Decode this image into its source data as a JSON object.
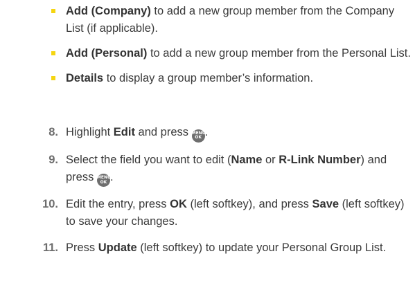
{
  "bullets": [
    {
      "bold": "Add (Company)",
      "text": " to add a new group member from the Company List (if applicable)."
    },
    {
      "bold": "Add (Personal)",
      "text": " to add a new group member from the Personal List."
    },
    {
      "bold": "Details",
      "text": " to display a group member’s information."
    }
  ],
  "steps": [
    {
      "num": "8.",
      "t1": "Highlight ",
      "b1": "Edit",
      "t2": " and press ",
      "key": [
        "MENU",
        "OK"
      ],
      "t3": "."
    },
    {
      "num": "9.",
      "t1": "Select the field you want to edit (",
      "b1": "Name",
      "t2": " or ",
      "b2": "R-Link Number",
      "t3": ") and press ",
      "key": [
        "MENU",
        "OK"
      ],
      "t4": "."
    },
    {
      "num": "10.",
      "t1": "Edit the entry, press ",
      "b1": "OK",
      "t2": " (left softkey), and press ",
      "b2": "Save",
      "t3": " (left softkey) to save your changes."
    },
    {
      "num": "11.",
      "t1": "Press ",
      "b1": "Update",
      "t2": " (left softkey) to update your Personal Group List."
    }
  ],
  "colors": {
    "bullet": "#f5d511",
    "text": "#3a3a3a",
    "number": "#6d6d6d",
    "menu_key": "#6e6e6e"
  },
  "icons": {
    "menu_ok_key": "menu-ok-key-icon",
    "bullet": "yellow-square-bullet"
  }
}
